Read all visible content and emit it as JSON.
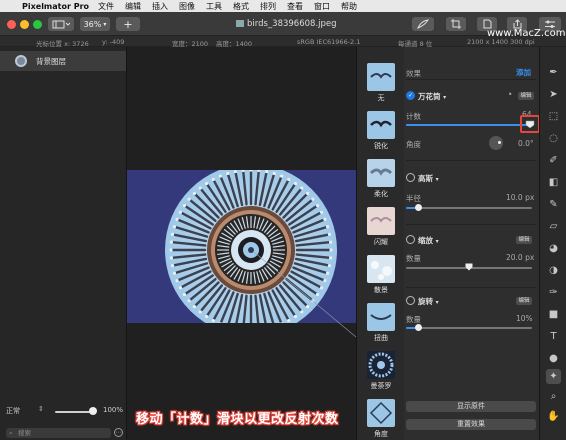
{
  "menubar": {
    "app_name": "Pixelmator Pro",
    "items": [
      "文件",
      "编辑",
      "插入",
      "图像",
      "工具",
      "格式",
      "排列",
      "查看",
      "窗口",
      "帮助"
    ]
  },
  "toolbar": {
    "zoom": "36%",
    "add_label": "+",
    "document_title": "birds_38396608.jpeg",
    "watermark": "www.MacZ.com"
  },
  "infobar": {
    "cursor_label": "光标位置 x: 3726",
    "cursor_y": "y: -409",
    "width": "宽度：2100",
    "height": "高度：1400",
    "color_profile": "sRGB IEC61966-2.1",
    "channel_depth": "每通道 8 位",
    "resolution": "2100 x 1400 300 dpi"
  },
  "layers": {
    "layer_name": "背景图层",
    "blend_mode": "正常",
    "opacity": "100%",
    "search_placeholder": "搜索"
  },
  "effects": [
    {
      "label": "无"
    },
    {
      "label": "锐化"
    },
    {
      "label": "柔化"
    },
    {
      "label": "闪耀"
    },
    {
      "label": "散景"
    },
    {
      "label": "扭曲"
    },
    {
      "label": "曼荼罗"
    },
    {
      "label": "角度"
    }
  ],
  "settings": {
    "header": "效果",
    "add": "添加",
    "kaleidoscope": {
      "title": "万花筒",
      "edit": "编辑",
      "count_label": "计数",
      "count_value": "64",
      "angle_label": "角度",
      "angle_value": "0.0°"
    },
    "gaussian": {
      "title": "高斯",
      "radius_label": "半径",
      "radius_value": "10.0 px",
      "radius_fraction": 0.1
    },
    "zoom": {
      "title": "缩放",
      "edit": "编辑",
      "amount_label": "数量",
      "amount_value": "20.0 px",
      "amount_fraction": 0.5
    },
    "spin": {
      "title": "旋转",
      "edit": "编辑",
      "amount_label": "数量",
      "amount_value": "10%",
      "amount_fraction": 0.1
    },
    "show_original": "显示原件",
    "reset": "重置效果"
  },
  "caption": "移动「计数」滑块以更改反射次数",
  "colors": {
    "accent": "#1f7ae0",
    "canvas_bg": "#33397a",
    "highlight": "#e8453c"
  }
}
